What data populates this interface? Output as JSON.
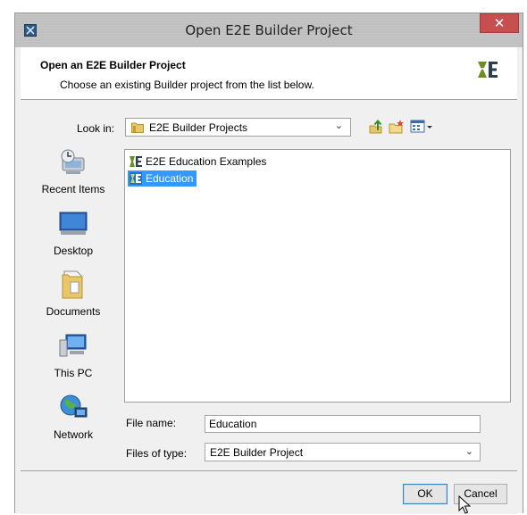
{
  "window": {
    "title": "Open E2E Builder Project",
    "close_label": "✕"
  },
  "header": {
    "title": "Open an E2E Builder Project",
    "subtitle": "Choose an existing Builder project from the list below."
  },
  "look_in": {
    "label": "Look in:",
    "value": "E2E Builder Projects"
  },
  "places": [
    {
      "label": "Recent Items",
      "icon": "recent-items-icon"
    },
    {
      "label": "Desktop",
      "icon": "desktop-icon"
    },
    {
      "label": "Documents",
      "icon": "documents-icon"
    },
    {
      "label": "This PC",
      "icon": "computer-icon"
    },
    {
      "label": "Network",
      "icon": "network-icon"
    }
  ],
  "files": [
    {
      "name": "E2E Education Examples",
      "icon": "e2e-project-icon",
      "selected": false
    },
    {
      "name": "Education",
      "icon": "e2e-project-icon",
      "selected": true
    }
  ],
  "file_name": {
    "label": "File name:",
    "value": "Education"
  },
  "file_type": {
    "label": "Files of type:",
    "value": "E2E Builder Project"
  },
  "buttons": {
    "ok": "OK",
    "cancel": "Cancel"
  },
  "colors": {
    "selection": "#3399ff",
    "close_button": "#c74f4f",
    "logo_green": "#6a8f1f",
    "logo_dark": "#2c3e50"
  }
}
